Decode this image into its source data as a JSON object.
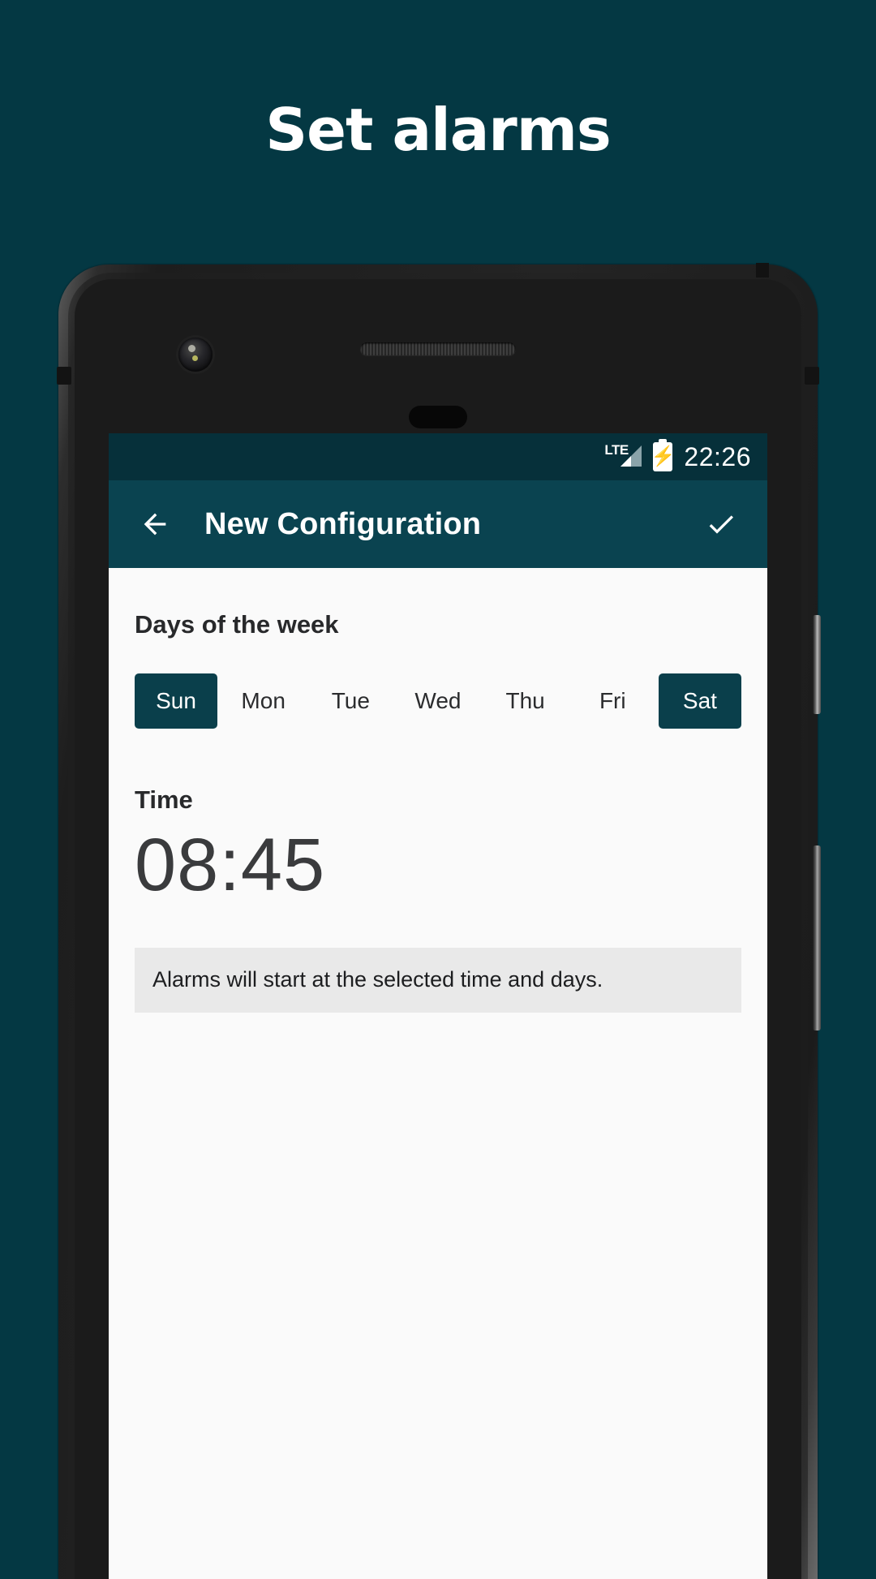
{
  "promo": {
    "headline": "Set alarms"
  },
  "phone": {
    "hardware": {
      "front_camera": "front-camera",
      "earpiece": "earpiece-speaker",
      "proximity_sensor": "proximity-sensor",
      "power_button": "power-button",
      "volume_button": "volume-rocker"
    }
  },
  "status_bar": {
    "network_label": "LTE",
    "battery_icon": "battery-charging-icon",
    "signal_icon": "signal-bars-icon",
    "time": "22:26",
    "background": "#06303a"
  },
  "app_bar": {
    "back_icon": "arrow-left-icon",
    "title": "New Configuration",
    "done_icon": "check-icon",
    "background": "#0a4350"
  },
  "content": {
    "days_section": {
      "label": "Days of the week",
      "chips": [
        {
          "label": "Sun",
          "selected": true
        },
        {
          "label": "Mon",
          "selected": false
        },
        {
          "label": "Tue",
          "selected": false
        },
        {
          "label": "Wed",
          "selected": false
        },
        {
          "label": "Thu",
          "selected": false
        },
        {
          "label": "Fri",
          "selected": false
        },
        {
          "label": "Sat",
          "selected": true
        }
      ],
      "selected_color": "#0a3f4b",
      "selected_text_color": "#ffffff"
    },
    "time_section": {
      "label": "Time",
      "value": "08:45"
    },
    "info_banner": {
      "text": "Alarms will start at the selected time and days.",
      "background": "#e9e9e9"
    },
    "background": "#fafafa"
  },
  "theme": {
    "page_background": "#043843",
    "accent": "#0a4350",
    "headline_color": "#ffffff"
  }
}
